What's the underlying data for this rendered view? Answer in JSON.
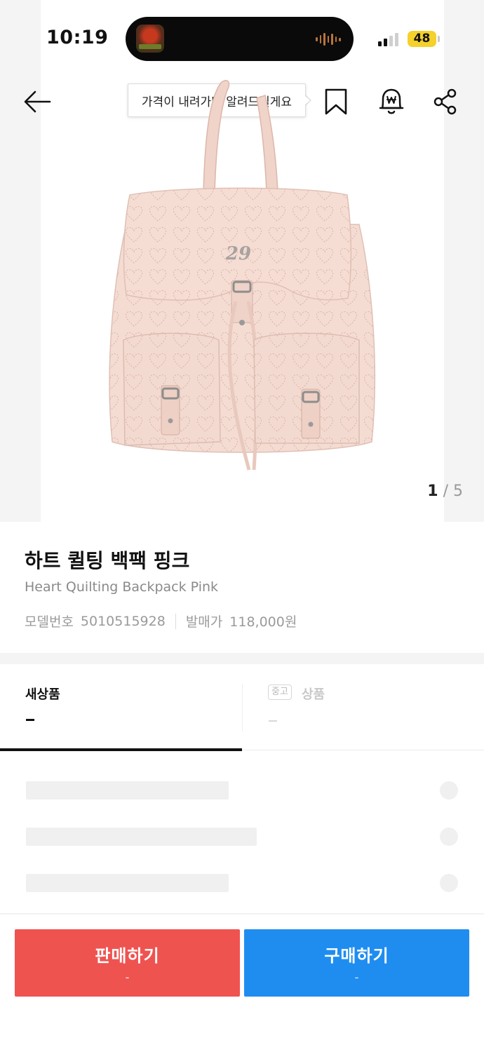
{
  "status_bar": {
    "time": "10:19",
    "battery": "48",
    "colors": {
      "battery": "#f4d12b"
    }
  },
  "header": {
    "back_icon": "arrow-left-icon",
    "price_alert_tooltip": "가격이 내려가면 알려드릴게요",
    "bookmark_icon": "bookmark-icon",
    "price_alarm_icon": "won-bell-icon",
    "share_icon": "share-icon"
  },
  "gallery": {
    "image": "pink-heart-quilted-backpack",
    "current": "1",
    "separator": "/",
    "total": "5"
  },
  "product": {
    "name_ko": "하트 퀼팅 백팩 핑크",
    "name_en": "Heart Quilting Backpack Pink",
    "model_label": "모델번호",
    "model_value": "5010515928",
    "release_price_label": "발매가",
    "release_price_value": "118,000원"
  },
  "condition_tabs": [
    {
      "label": "새상품",
      "price": "-",
      "selected": true
    },
    {
      "badge": "중고",
      "label": "상품",
      "price": "-",
      "selected": false
    }
  ],
  "actions": {
    "sell_label": "판매하기",
    "sell_price": "-",
    "buy_label": "구매하기",
    "buy_price": "-",
    "colors": {
      "sell": "#ef5350",
      "buy": "#1f8df0"
    }
  }
}
